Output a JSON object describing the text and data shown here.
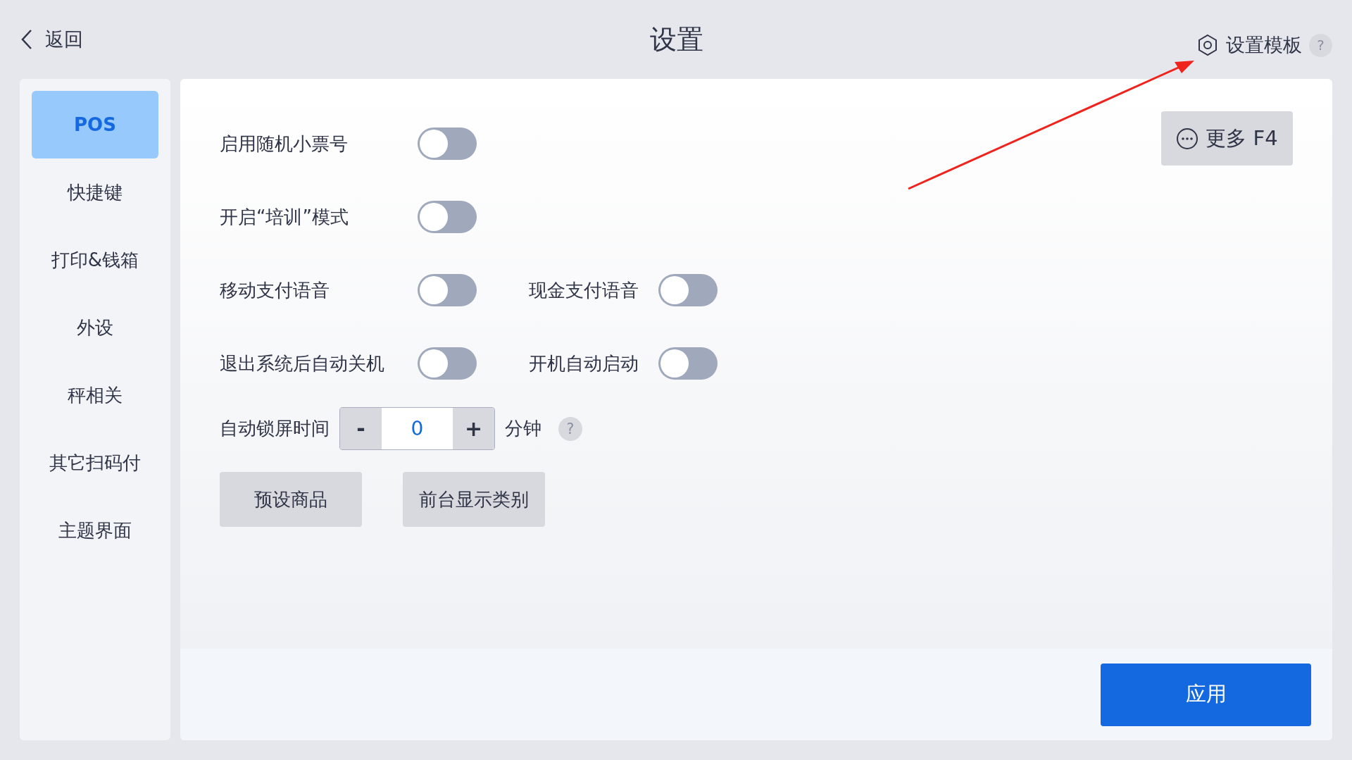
{
  "header": {
    "back": "返回",
    "title": "设置",
    "template_link": "设置模板",
    "help": "?"
  },
  "sidebar": {
    "items": [
      {
        "label": "POS",
        "selected": true
      },
      {
        "label": "快捷键",
        "selected": false
      },
      {
        "label": "打印&钱箱",
        "selected": false
      },
      {
        "label": "外设",
        "selected": false
      },
      {
        "label": "秤相关",
        "selected": false
      },
      {
        "label": "其它扫码付",
        "selected": false
      },
      {
        "label": "主题界面",
        "selected": false
      }
    ]
  },
  "more_button": "更多 F4",
  "toggle_rows": [
    [
      {
        "label": "启用随机小票号",
        "on": false
      }
    ],
    [
      {
        "label": "开启“培训”模式",
        "on": false
      }
    ],
    [
      {
        "label": "移动支付语音",
        "on": false
      },
      {
        "label": "现金支付语音",
        "on": false
      }
    ],
    [
      {
        "label": "退出系统后自动关机",
        "on": false
      },
      {
        "label": "开机自动启动",
        "on": false
      }
    ]
  ],
  "lock_time": {
    "label": "自动锁屏时间",
    "minus": "-",
    "value": "0",
    "plus": "+",
    "unit": "分钟",
    "help": "?"
  },
  "buttons": [
    "预设商品",
    "前台显示类别"
  ],
  "apply_button": "应用"
}
